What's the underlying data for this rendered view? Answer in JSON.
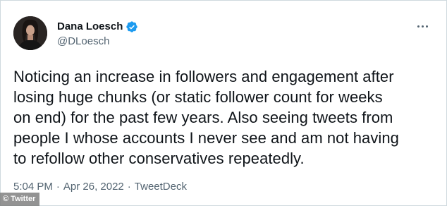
{
  "tweet": {
    "author": {
      "display_name": "Dana Loesch",
      "handle": "@DLoesch",
      "verified": true,
      "avatar_icon": "profile-photo"
    },
    "text": "Noticing an increase in followers and engagement after\nlosing huge chunks (or static follower count for weeks\non end) for the past few years. Also seeing tweets from\npeople I whose accounts I never see and am not having\nto refollow other conservatives repeatedly.",
    "meta": {
      "time": "5:04 PM",
      "separator": "·",
      "date": "Apr 26, 2022",
      "source": "TweetDeck"
    },
    "more_icon": "more-horizontal-icon"
  },
  "watermark": {
    "text": "© Twitter"
  },
  "colors": {
    "text_primary": "#0f1419",
    "text_secondary": "#536471",
    "verified_blue": "#1d9bf0",
    "border": "#cfd9de"
  }
}
